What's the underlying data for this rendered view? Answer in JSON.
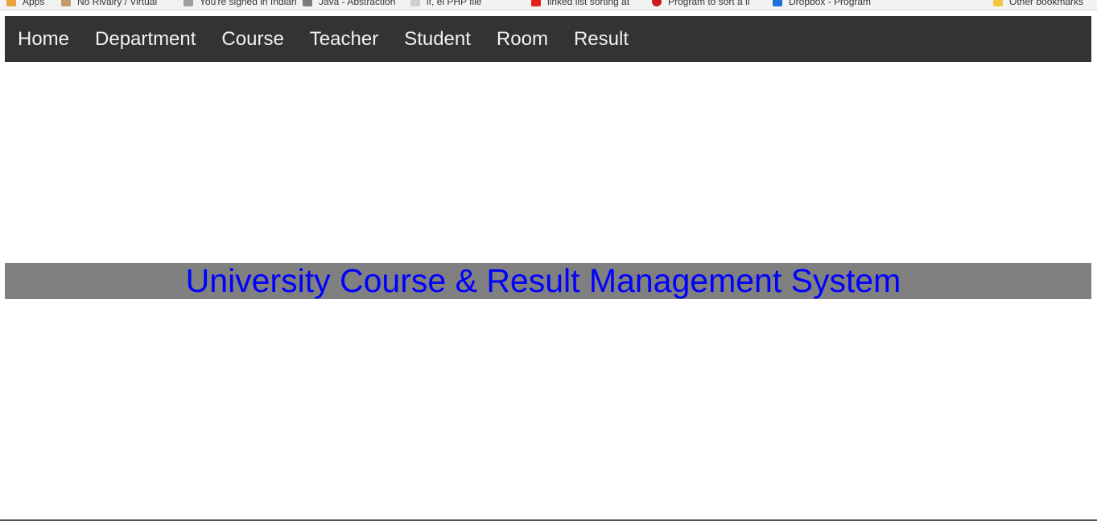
{
  "bookmarks": [
    {
      "label": "Apps",
      "icon": "apps-grid-icon",
      "color": "#e8a33d"
    },
    {
      "label": "No Rivalry / Virtual",
      "icon": "bookmark-site-icon",
      "color": "#c49a6c"
    },
    {
      "label": "You're signed in Indian",
      "icon": "document-icon",
      "color": "#9e9e9e"
    },
    {
      "label": "Java - Abstraction",
      "icon": "tag-icon",
      "color": "#7a7a7a"
    },
    {
      "label": "if, ei PHP file",
      "icon": "page-icon",
      "color": "#cfcfcf"
    },
    {
      "label": "linked list sorting at",
      "icon": "youtube-icon",
      "color": "#e62117"
    },
    {
      "label": "Program to sort a li",
      "icon": "opera-icon",
      "color": "#cc1b1b"
    },
    {
      "label": "Dropbox - Program",
      "icon": "dropbox-icon",
      "color": "#1e73d6"
    },
    {
      "label": "Other bookmarks",
      "icon": "folder-icon",
      "color": "#f5c542"
    }
  ],
  "nav": {
    "items": [
      {
        "label": "Home"
      },
      {
        "label": "Department"
      },
      {
        "label": "Course"
      },
      {
        "label": "Teacher"
      },
      {
        "label": "Student"
      },
      {
        "label": "Room"
      },
      {
        "label": "Result"
      }
    ]
  },
  "banner": {
    "title": "University Course & Result Management System"
  },
  "colors": {
    "nav_background": "#333333",
    "nav_text": "#f2f2f2",
    "banner_background": "#808080",
    "banner_text": "#0000ff"
  }
}
